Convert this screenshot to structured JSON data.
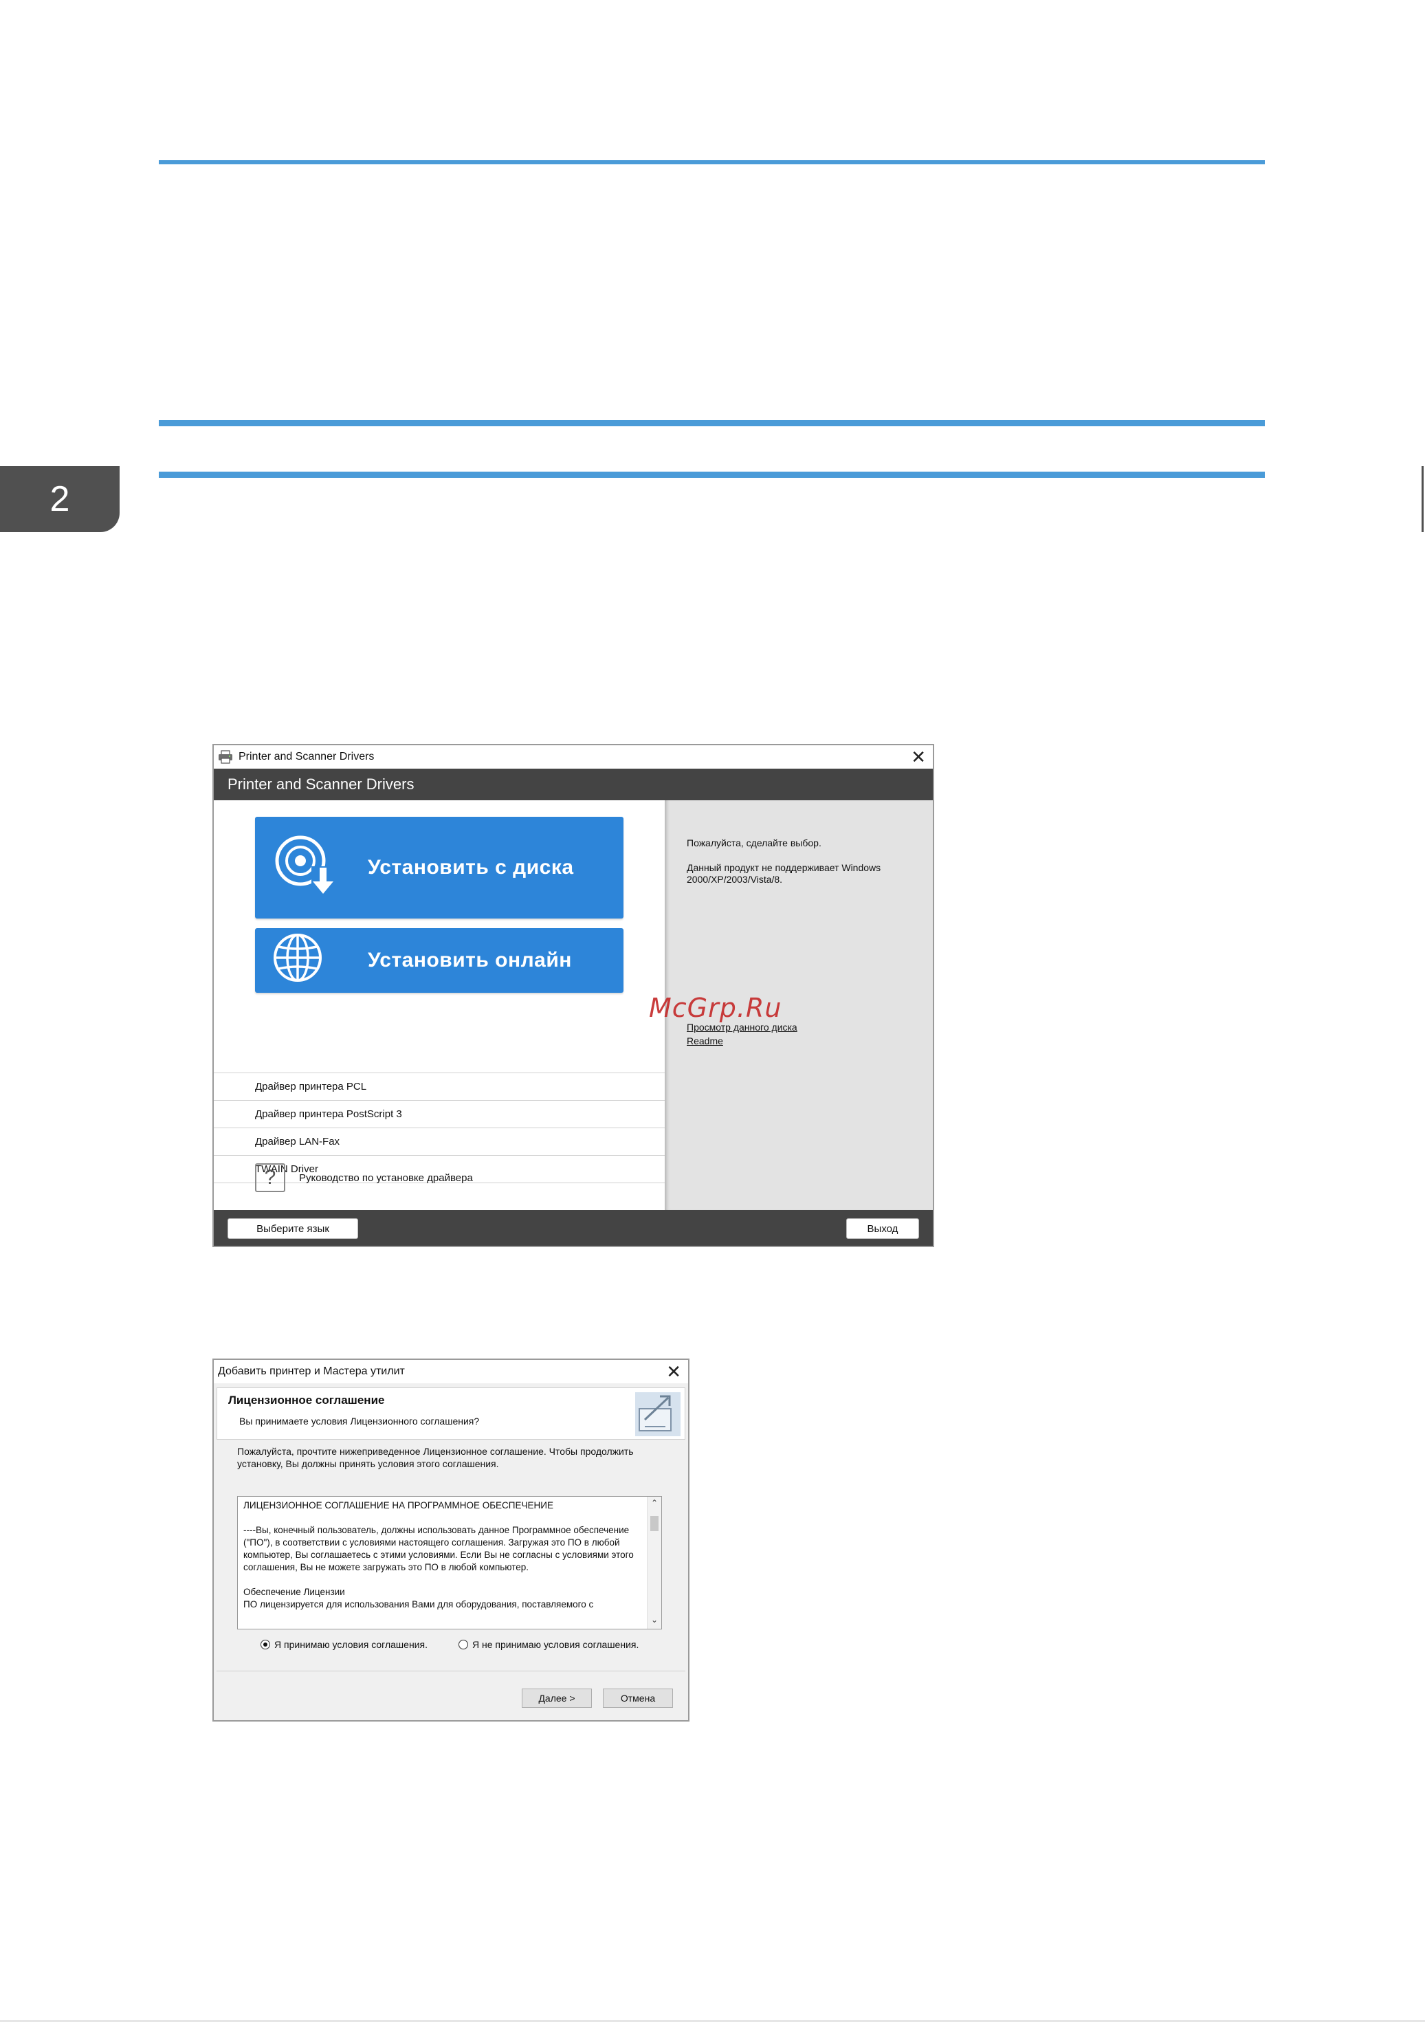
{
  "page": {
    "chapter_number": "2",
    "accent_color": "#4a9bd8"
  },
  "window1": {
    "titlebar": "Printer and Scanner Drivers",
    "header": "Printer and Scanner Drivers",
    "install_disc_label": "Установить с диска",
    "install_online_label": "Установить онлайн",
    "drivers": [
      "Драйвер принтера PCL",
      "Драйвер принтера PostScript 3",
      "Драйвер LAN-Fax",
      "TWAIN Driver"
    ],
    "guide_label": "Руководство по установке драйвера",
    "right_panel": {
      "prompt": "Пожалуйста, сделайте выбор.",
      "note": "Данный продукт не поддерживает Windows 2000/XP/2003/Vista/8.",
      "browse_link": "Просмотр данного диска",
      "readme_link": "Readme"
    },
    "footer": {
      "language_button": "Выберите язык",
      "exit_button": "Выход"
    },
    "watermark": "McGrp.Ru"
  },
  "window2": {
    "titlebar": "Добавить принтер и Мастера утилит",
    "heading": "Лицензионное соглашение",
    "subheading": "Вы принимаете условия Лицензионного соглашения?",
    "intro": "Пожалуйста, прочтите нижеприведенное Лицензионное соглашение. Чтобы продолжить установку, Вы должны принять условия этого соглашения.",
    "license_paragraphs": [
      "ЛИЦЕНЗИОННОЕ СОГЛАШЕНИЕ НА ПРОГРАММНОЕ ОБЕСПЕЧЕНИЕ",
      "----Вы, конечный пользователь, должны использовать данное Программное обеспечение (\"ПО\"), в соответствии с условиями настоящего соглашения. Загружая это ПО в любой компьютер, Вы соглашаетесь с этими условиями. Если Вы не согласны с условиями этого соглашения, Вы не можете загружать это ПО в любой компьютер.",
      "Обеспечение Лицензии\nПО лицензируется для использования Вами для оборудования, поставляемого с"
    ],
    "accept_label": "Я принимаю условия соглашения.",
    "decline_label": "Я не принимаю условия соглашения.",
    "accept_selected": true,
    "next_button": "Далее >",
    "cancel_button": "Отмена"
  }
}
